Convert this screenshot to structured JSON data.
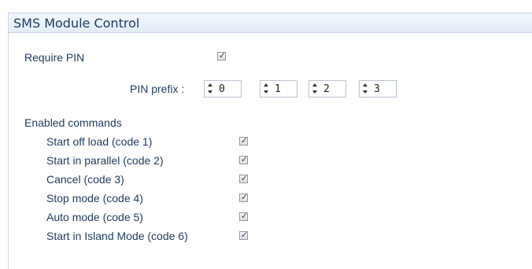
{
  "panel": {
    "title": "SMS Module Control"
  },
  "require_pin": {
    "label": "Require PIN",
    "checked": true
  },
  "pin_prefix": {
    "label": "PIN prefix :",
    "digits": [
      "0",
      "1",
      "2",
      "3"
    ]
  },
  "enabled_commands": {
    "heading": "Enabled commands",
    "items": [
      {
        "label": "Start off load (code 1)",
        "checked": true
      },
      {
        "label": "Start in parallel (code 2)",
        "checked": true
      },
      {
        "label": "Cancel (code 3)",
        "checked": true
      },
      {
        "label": "Stop mode (code 4)",
        "checked": true
      },
      {
        "label": "Auto mode (code 5)",
        "checked": true
      },
      {
        "label": "Start in Island Mode (code 6)",
        "checked": true
      }
    ]
  },
  "check_glyph": "✓"
}
